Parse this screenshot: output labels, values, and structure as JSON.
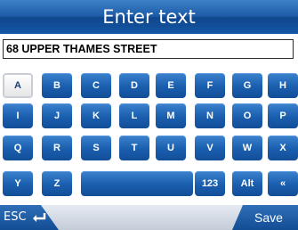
{
  "title": "Enter text",
  "input": {
    "value": "68 UPPER THAMES STREET"
  },
  "keyboard": {
    "selected_key": "A",
    "row1": [
      "A",
      "B",
      "C",
      "D",
      "E",
      "F",
      "G",
      "H"
    ],
    "row2": [
      "I",
      "J",
      "K",
      "L",
      "M",
      "N",
      "O",
      "P"
    ],
    "row3": [
      "Q",
      "R",
      "S",
      "T",
      "U",
      "V",
      "W",
      "X"
    ],
    "row4": {
      "y": "Y",
      "z": "Z",
      "space": "",
      "numbers": "123",
      "alt": "Alt",
      "back": "«"
    }
  },
  "footer": {
    "esc_label": "ESC",
    "save_label": "Save"
  },
  "colors": {
    "accent": "#1a5eae",
    "title_bar": "#1456a3",
    "footer_bar": "#d3d9e2"
  },
  "icons": {
    "enter": "enter-arrow-icon"
  }
}
